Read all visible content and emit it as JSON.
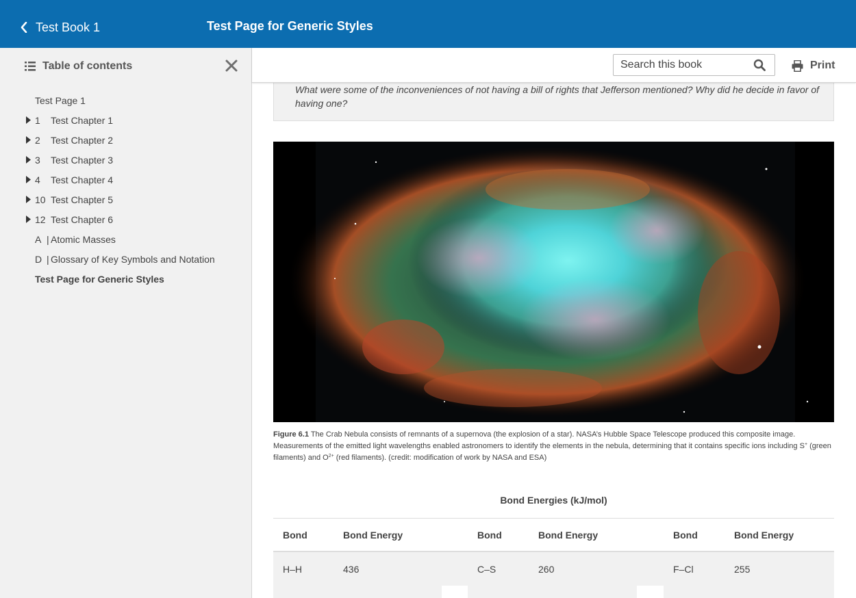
{
  "header": {
    "back_label": "Test Book 1",
    "page_title": "Test Page for Generic Styles",
    "brand_color": "#0c6db0"
  },
  "toolbar": {
    "search_placeholder": "Search this book",
    "print_label": "Print"
  },
  "sidebar": {
    "title": "Table of contents",
    "items": [
      {
        "type": "plain",
        "label": "Test Page 1"
      },
      {
        "type": "chapter",
        "num": "1",
        "label": "Test Chapter 1"
      },
      {
        "type": "chapter",
        "num": "2",
        "label": "Test Chapter 2"
      },
      {
        "type": "chapter",
        "num": "3",
        "label": "Test Chapter 3"
      },
      {
        "type": "chapter",
        "num": "4",
        "label": "Test Chapter 4"
      },
      {
        "type": "chapter",
        "num": "10",
        "label": "Test Chapter 5"
      },
      {
        "type": "chapter",
        "num": "12",
        "label": "Test Chapter 6"
      },
      {
        "type": "appendix",
        "num": "A",
        "label": "Atomic Masses"
      },
      {
        "type": "appendix",
        "num": "D",
        "label": "Glossary of Key Symbols and Notation"
      },
      {
        "type": "plain",
        "label": "Test Page for Generic Styles",
        "active": true
      }
    ]
  },
  "content": {
    "note_text": "What were some of the inconveniences of not having a bill of rights that Jefferson mentioned? Why did he decide in favor of having one?",
    "figure": {
      "label": "Figure 6.1",
      "caption_part1": " The Crab Nebula consists of remnants of a supernova (the explosion of a star). NASA’s Hubble Space Telescope produced this composite image. Measurements of the emitted light wavelengths enabled astronomers to identify the elements in the nebula, determining that it contains specific ions including S",
      "sup1": "+",
      "caption_part2": " (green filaments) and O",
      "sup2": "2+",
      "caption_part3": " (red filaments). (credit: modification of work by NASA and ESA)"
    },
    "table": {
      "title": "Bond Energies (kJ/mol)",
      "headers": [
        "Bond",
        "Bond Energy",
        "Bond",
        "Bond Energy",
        "Bond",
        "Bond Energy"
      ],
      "rows": [
        [
          "H–H",
          "436",
          "C–S",
          "260",
          "F–Cl",
          "255"
        ]
      ]
    }
  }
}
